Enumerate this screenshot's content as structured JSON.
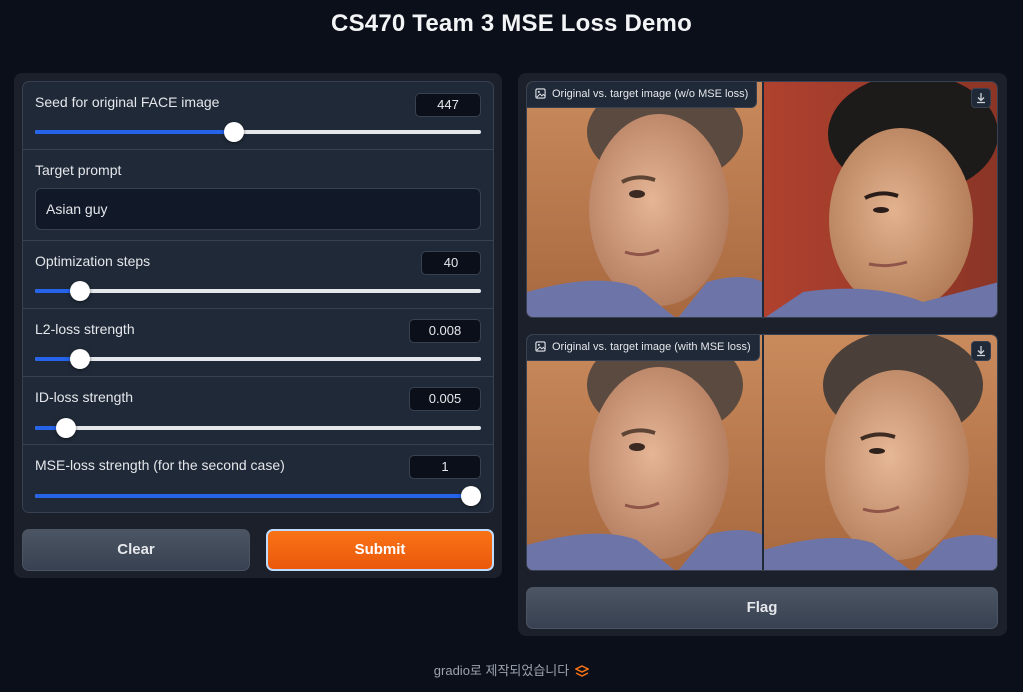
{
  "app": {
    "title": "CS470 Team 3 MSE Loss Demo"
  },
  "inputs": {
    "seed": {
      "label": "Seed for original FACE image",
      "value": "447",
      "fraction": 0.447
    },
    "prompt": {
      "label": "Target prompt",
      "value": "Asian guy"
    },
    "steps": {
      "label": "Optimization steps",
      "value": "40",
      "fraction": 0.1
    },
    "l2": {
      "label": "L2-loss strength",
      "value": "0.008",
      "fraction": 0.1
    },
    "id": {
      "label": "ID-loss strength",
      "value": "0.005",
      "fraction": 0.07
    },
    "mse": {
      "label": "MSE-loss strength (for the second case)",
      "value": "1",
      "fraction": 1.0
    }
  },
  "buttons": {
    "clear": "Clear",
    "submit": "Submit",
    "flag": "Flag"
  },
  "outputs": {
    "without_mse": {
      "label": "Original vs. target image (w/o MSE loss)",
      "icon": "image-icon"
    },
    "with_mse": {
      "label": "Original vs. target image (with MSE loss)",
      "icon": "image-icon"
    }
  },
  "footer": {
    "text": "gradio로 제작되었습니다",
    "icon": "gradio-logo-icon"
  },
  "colors": {
    "accent": "#f97316",
    "slider": "#2563eb",
    "background": "#0b0f19",
    "panel": "#1b202b"
  }
}
